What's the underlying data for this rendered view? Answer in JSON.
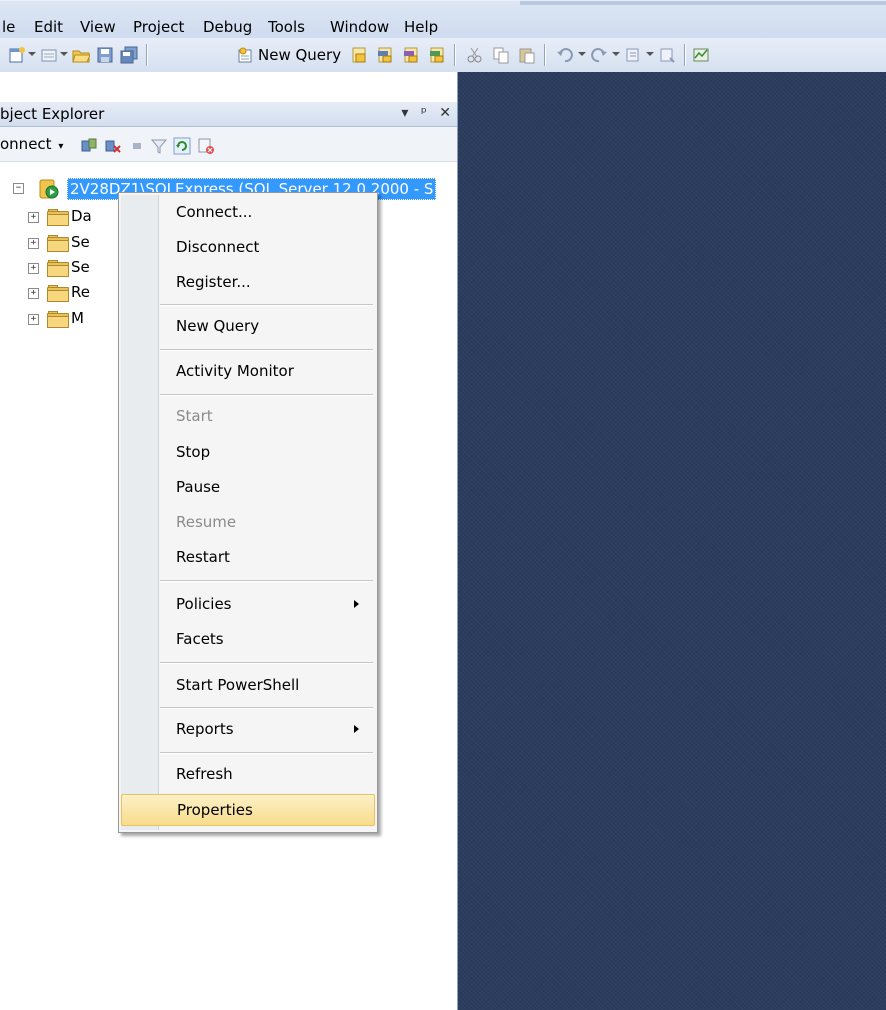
{
  "menubar": {
    "items": [
      "le",
      "Edit",
      "View",
      "Project",
      "Debug",
      "Tools",
      "Window",
      "Help"
    ]
  },
  "toolbar": {
    "new_query_label": "New Query"
  },
  "object_explorer": {
    "title": "bject Explorer",
    "title_buttons": [
      "▾",
      "ᵖ",
      "✕"
    ],
    "connect_label": "onnect"
  },
  "tree": {
    "server_label": "2V28DZ1\\SQLExpress (SQL Server 12.0.2000 - S",
    "folders": [
      "Da",
      "Se",
      "Se",
      "Re",
      "M"
    ]
  },
  "context_menu": {
    "items": [
      {
        "label": "Connect...",
        "enabled": true
      },
      {
        "label": "Disconnect",
        "enabled": true
      },
      {
        "label": "Register...",
        "enabled": true
      },
      {
        "label": "New Query",
        "enabled": true
      },
      {
        "label": "Activity Monitor",
        "enabled": true
      },
      {
        "label": "Start",
        "enabled": false
      },
      {
        "label": "Stop",
        "enabled": true
      },
      {
        "label": "Pause",
        "enabled": true
      },
      {
        "label": "Resume",
        "enabled": false
      },
      {
        "label": "Restart",
        "enabled": true
      },
      {
        "label": "Policies",
        "enabled": true,
        "submenu": true
      },
      {
        "label": "Facets",
        "enabled": true
      },
      {
        "label": "Start PowerShell",
        "enabled": true
      },
      {
        "label": "Reports",
        "enabled": true,
        "submenu": true
      },
      {
        "label": "Refresh",
        "enabled": true
      },
      {
        "label": "Properties",
        "enabled": true,
        "highlighted": true
      }
    ]
  },
  "colors": {
    "selection": "#3399ff",
    "highlight": "#f8dc8c",
    "doc_background": "#2b3c5e"
  }
}
